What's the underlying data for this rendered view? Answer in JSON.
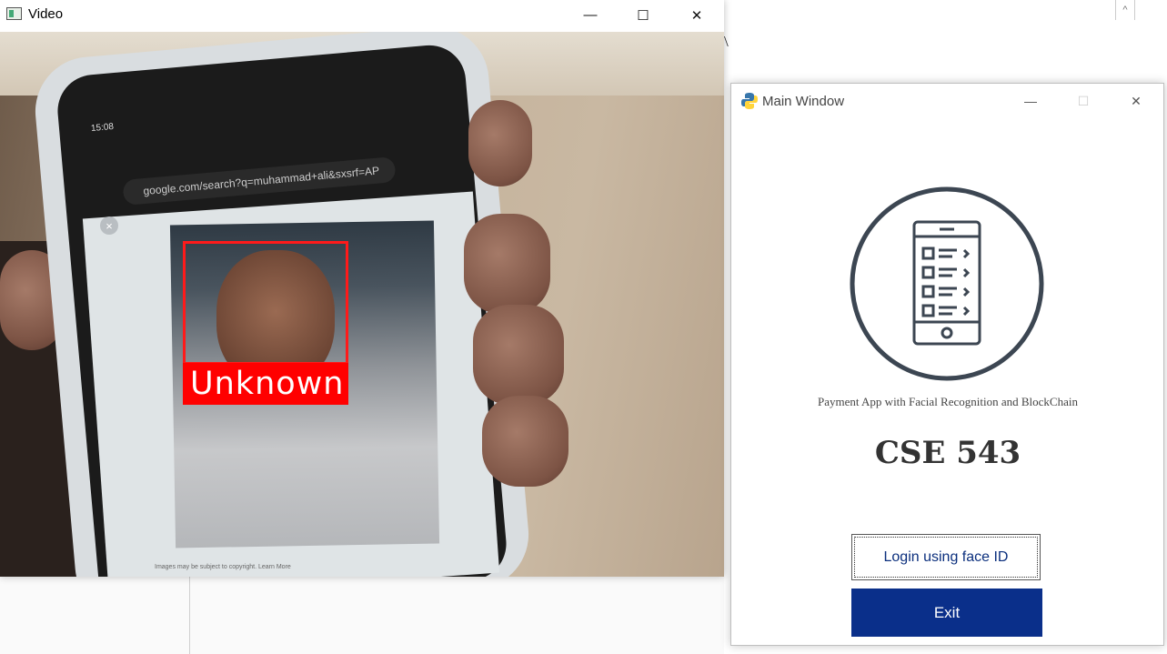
{
  "video_window": {
    "title": "Video",
    "minimize_glyph": "—",
    "maximize_glyph": "☐",
    "close_glyph": "✕",
    "phone": {
      "time": "15:08",
      "url": "google.com/search?q=muhammad+ali&sxsrf=AP",
      "copyright_note": "Images may be subject to copyright. Learn More"
    },
    "face_label": "Unknown",
    "colors": {
      "face_box": "#ff1a1a",
      "label_bg": "#ff0000"
    }
  },
  "main_window": {
    "title": "Main Window",
    "minimize_glyph": "—",
    "maximize_glyph": "☐",
    "close_glyph": "✕",
    "subtitle": "Payment App with Facial Recognition and BlockChain",
    "course": "CSE 543",
    "login_button": "Login using face ID",
    "exit_button": "Exit",
    "colors": {
      "exit_bg": "#0a2f8a",
      "login_text": "#0b2f7d",
      "logo_stroke": "#3c4652"
    }
  },
  "background_doc": {
    "scroll_up_glyph": "^"
  }
}
